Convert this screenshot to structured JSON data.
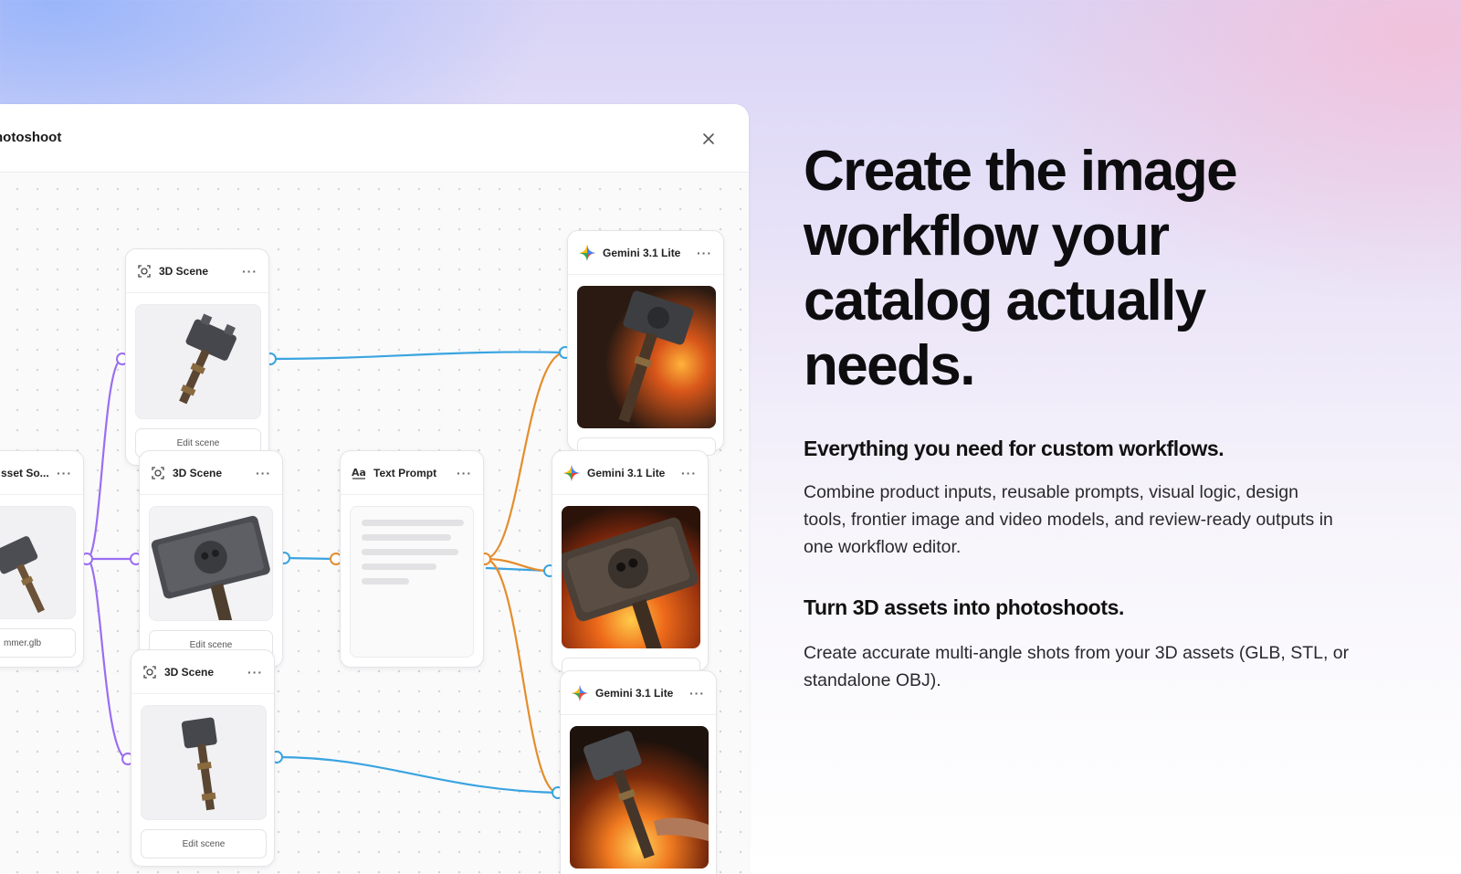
{
  "editor": {
    "title": "hotoshoot",
    "nodes": {
      "asset_source": {
        "title": "sset So...",
        "filename": "mmer.glb"
      },
      "scene_top": {
        "title": "3D Scene",
        "button": "Edit scene"
      },
      "scene_mid": {
        "title": "3D Scene",
        "button": "Edit scene"
      },
      "scene_bottom": {
        "title": "3D Scene",
        "button": "Edit scene"
      },
      "text_prompt": {
        "title": "Text Prompt"
      },
      "gemini_top": {
        "title": "Gemini 3.1 Lite"
      },
      "gemini_mid": {
        "title": "Gemini 3.1 Lite"
      },
      "gemini_bottom": {
        "title": "Gemini 3.1 Lite"
      }
    },
    "colors": {
      "edge_image": "#3aa4e0",
      "edge_prompt": "#e58d2c",
      "edge_source": "#9a6ef0"
    }
  },
  "content": {
    "headline": "Create the image workflow your catalog actually needs.",
    "section1_title": "Everything you need for custom workflows.",
    "section1_body": "Combine product inputs, reusable prompts, visual logic, design tools, frontier image and video models, and review-ready outputs in one workflow editor.",
    "section2_title": "Turn 3D assets into photoshoots.",
    "section2_body": "Create accurate multi-angle shots from your 3D assets (GLB, STL, or standalone OBJ)."
  }
}
